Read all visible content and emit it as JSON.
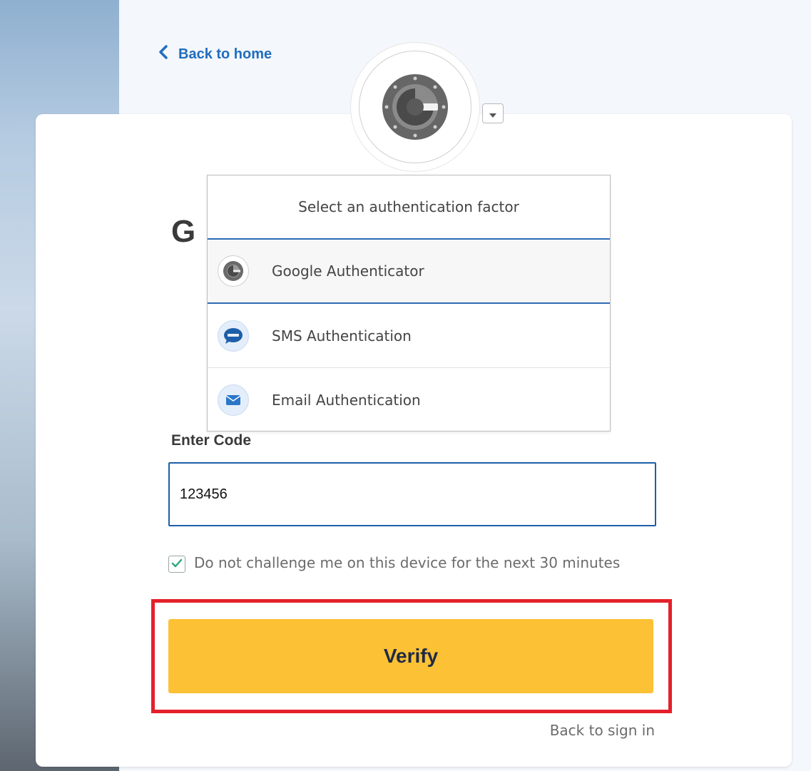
{
  "nav": {
    "back_to_home": "Back to home"
  },
  "factor": {
    "current": "Google Authenticator",
    "icon": "google-authenticator-icon",
    "dropdown_icon": "caret-down-icon"
  },
  "page": {
    "title_visible": "G"
  },
  "menu": {
    "header": "Select an authentication factor",
    "items": [
      {
        "label": "Google Authenticator",
        "icon": "google-authenticator-icon",
        "active": true
      },
      {
        "label": "SMS Authentication",
        "icon": "sms-icon",
        "active": false
      },
      {
        "label": "Email Authentication",
        "icon": "email-icon",
        "active": false
      }
    ]
  },
  "form": {
    "code_label": "Enter Code",
    "code_value": "123456",
    "remember_label": "Do not challenge me on this device for the next 30 minutes",
    "remember_checked": true,
    "verify_label": "Verify",
    "back_to_signin": "Back to sign in"
  },
  "colors": {
    "accent_blue": "#1f6dbf",
    "button_yellow": "#fcc134",
    "highlight_red": "#e4202b",
    "checkbox_green": "#2aa87a"
  }
}
